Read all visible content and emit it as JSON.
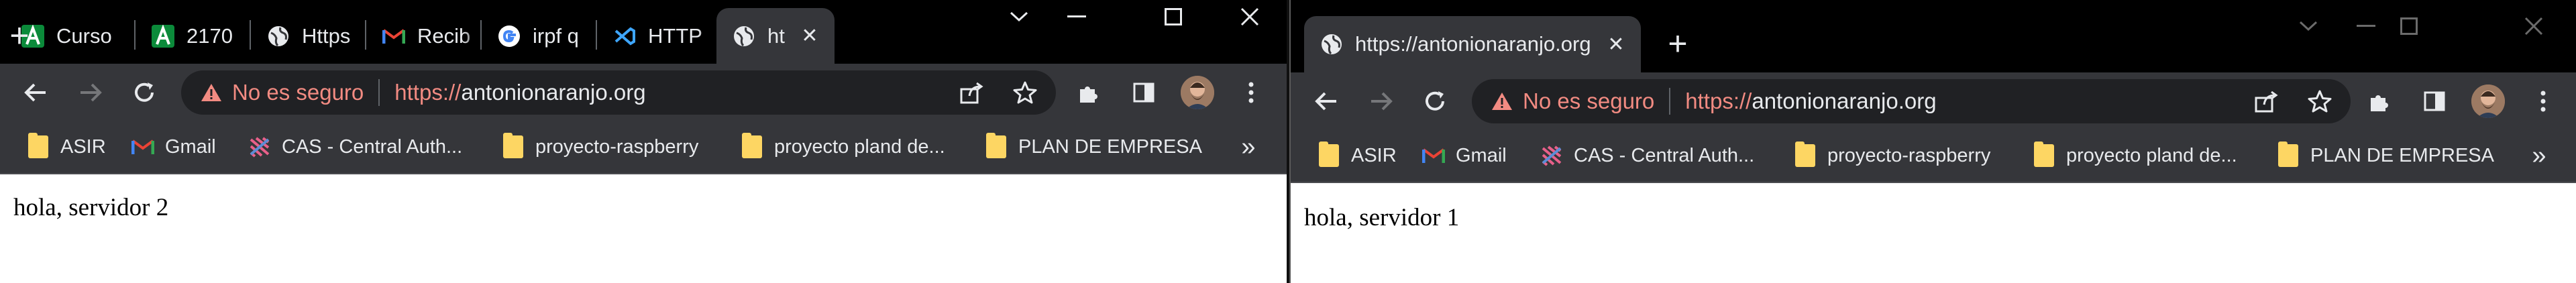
{
  "left_window": {
    "tabs": [
      {
        "title": "Curso",
        "icon": "andalucia-icon"
      },
      {
        "title": "2170",
        "icon": "andalucia-icon"
      },
      {
        "title": "Https",
        "icon": "globe-icon"
      },
      {
        "title": "Recib",
        "icon": "gmail-icon"
      },
      {
        "title": "irpf q",
        "icon": "google-icon"
      },
      {
        "title": "HTTP",
        "icon": "vscode-icon"
      },
      {
        "title": "ht",
        "icon": "globe-icon",
        "active": true
      }
    ],
    "omnibox": {
      "security_label": "No es seguro",
      "url_scheme": "https://",
      "url_host": "antonionaranjo.org"
    },
    "bookmarks": [
      {
        "label": "ASIR",
        "icon": "folder-icon"
      },
      {
        "label": "Gmail",
        "icon": "gmail-icon"
      },
      {
        "label": "CAS - Central Auth...",
        "icon": "cas-icon"
      },
      {
        "label": "proyecto-raspberry",
        "icon": "folder-icon"
      },
      {
        "label": "proyecto pland de...",
        "icon": "folder-icon"
      },
      {
        "label": "PLAN DE EMPRESA",
        "icon": "folder-icon"
      }
    ],
    "bookmarks_more": "»",
    "page_text": "hola, servidor 2"
  },
  "right_window": {
    "tabs": [
      {
        "title": "https://antonionaranjo.org",
        "icon": "globe-icon",
        "active": true
      }
    ],
    "omnibox": {
      "security_label": "No es seguro",
      "url_scheme": "https://",
      "url_host": "antonionaranjo.org"
    },
    "bookmarks": [
      {
        "label": "ASIR",
        "icon": "folder-icon"
      },
      {
        "label": "Gmail",
        "icon": "gmail-icon"
      },
      {
        "label": "CAS - Central Auth...",
        "icon": "cas-icon"
      },
      {
        "label": "proyecto-raspberry",
        "icon": "folder-icon"
      },
      {
        "label": "proyecto pland de...",
        "icon": "folder-icon"
      },
      {
        "label": "PLAN DE EMPRESA",
        "icon": "folder-icon"
      }
    ],
    "bookmarks_more": "»",
    "page_text": "hola, servidor 1"
  },
  "colors": {
    "frame": "#000000",
    "toolbar": "#35363a",
    "omnibox": "#202124",
    "insecure": "#f28b82",
    "text": "#e8eaed",
    "folder": "#fdd663"
  }
}
